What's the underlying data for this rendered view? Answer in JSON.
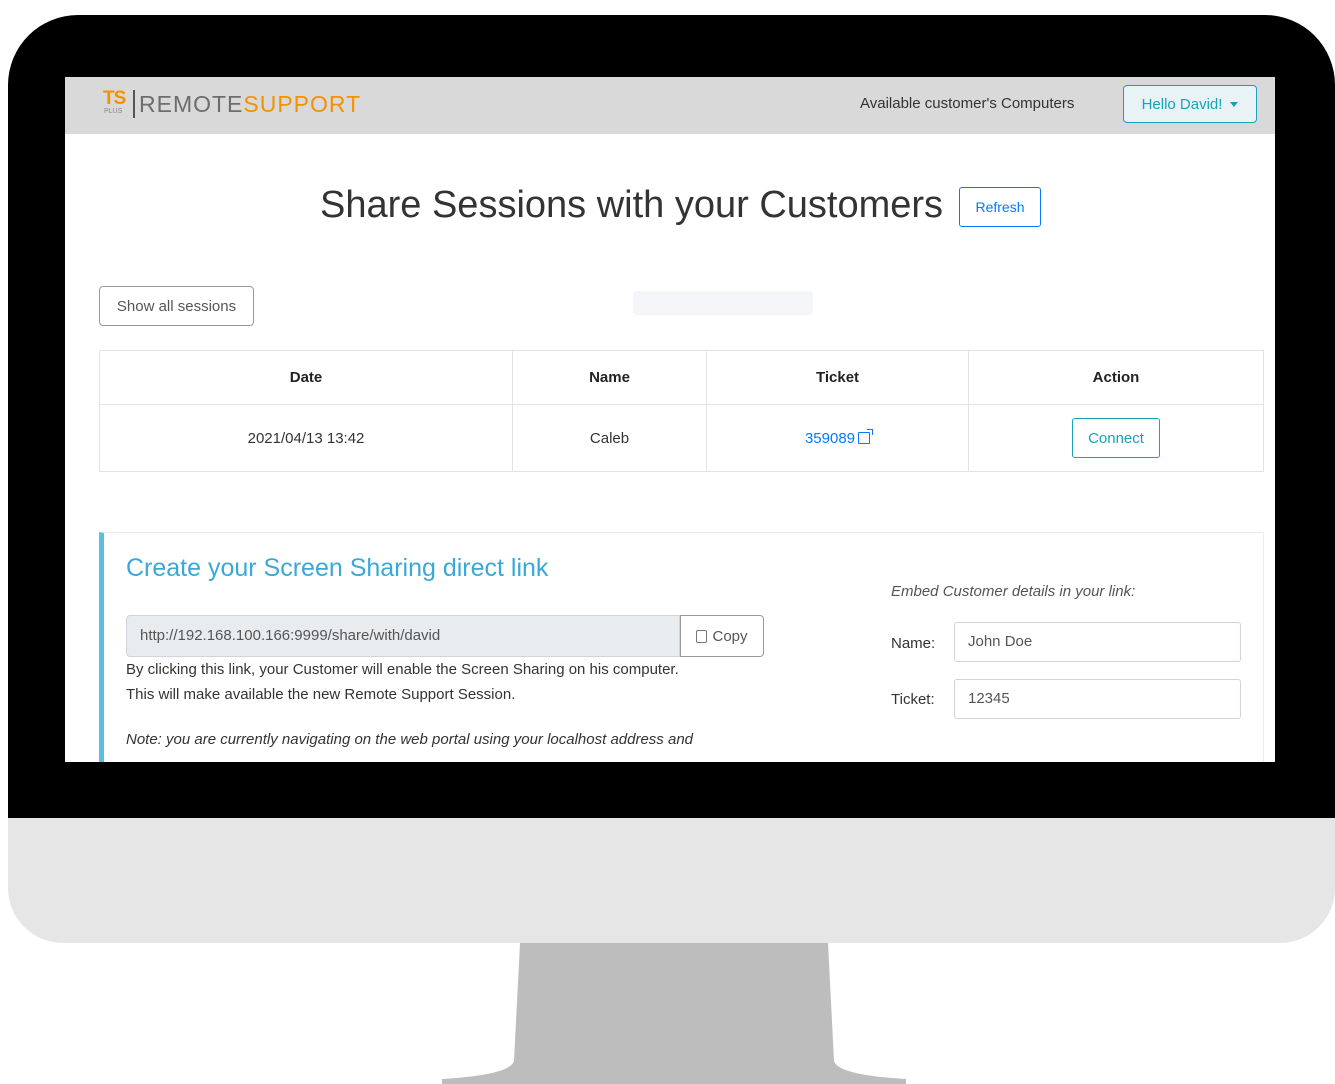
{
  "brand": {
    "ts": "TS",
    "plus": "PLUS",
    "word_remote": "REMOTE",
    "word_support": "SUPPORT"
  },
  "nav": {
    "link": "Available customer's Computers",
    "user_menu": "Hello David!"
  },
  "page": {
    "title": "Share Sessions with your Customers",
    "refresh_label": "Refresh",
    "show_all_label": "Show all sessions"
  },
  "sessions_table": {
    "headers": [
      "Date",
      "Name",
      "Ticket",
      "Action"
    ],
    "rows": [
      {
        "date": "2021/04/13 13:42",
        "name": "Caleb",
        "ticket": "359089",
        "action": "Connect"
      }
    ]
  },
  "share_card": {
    "title": "Create your Screen Sharing direct link",
    "link_value": "http://192.168.100.166:9999/share/with/david",
    "copy_label": "Copy",
    "desc_line1": "By clicking this link, your Customer will enable the Screen Sharing on his computer.",
    "desc_line2": "This will make available the new Remote Support Session.",
    "note": "Note: you are currently navigating on the web portal using your localhost address and",
    "embed_title": "Embed Customer details in your link:",
    "name_label": "Name:",
    "name_value": "John Doe",
    "ticket_label": "Ticket:",
    "ticket_value": "12345"
  },
  "colors": {
    "accent": "#17a2b8",
    "brand_orange": "#f39200",
    "link_blue": "#007bff",
    "card_accent": "#5bc0de"
  }
}
